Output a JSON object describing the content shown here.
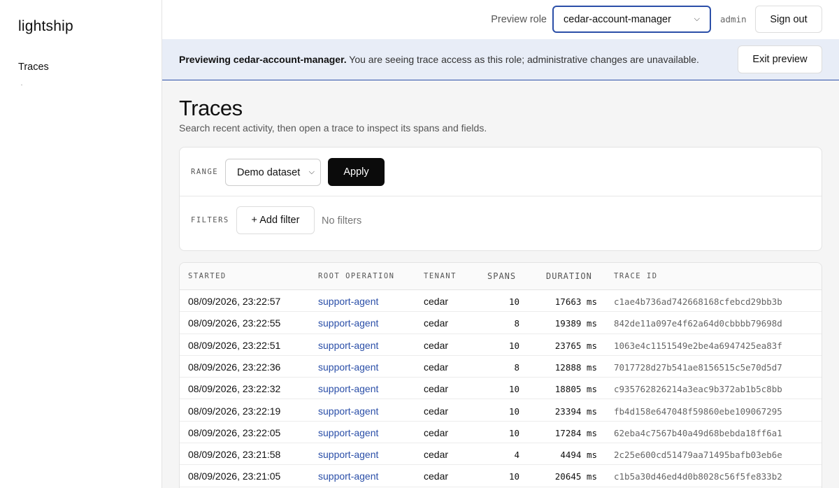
{
  "app": {
    "brand": "lightship"
  },
  "sidebar": {
    "items": [
      {
        "label": "Traces"
      }
    ]
  },
  "topbar": {
    "role_label": "Preview role",
    "role_value": "cedar-account-manager",
    "user": "admin",
    "signout_label": "Sign out"
  },
  "banner": {
    "bold": "Previewing cedar-account-manager.",
    "text": " You are seeing trace access as this role; administrative changes are unavailable.",
    "exit_label": "Exit preview"
  },
  "page": {
    "title": "Traces",
    "subtitle": "Search recent activity, then open a trace to inspect its spans and fields."
  },
  "filters": {
    "range_label": "RANGE",
    "range_value": "Demo dataset",
    "apply_label": "Apply",
    "filters_label": "FILTERS",
    "add_filter_label": "+ Add filter",
    "empty_label": "No filters"
  },
  "table": {
    "columns": [
      "STARTED",
      "ROOT OPERATION",
      "TENANT",
      "SPANS",
      "DURATION",
      "TRACE ID"
    ],
    "rows": [
      {
        "started": "08/09/2026, 23:22:57",
        "operation": "support-agent",
        "tenant": "cedar",
        "spans": "10",
        "duration": "17663 ms",
        "trace_id": "c1ae4b736ad742668168cfebcd29bb3b"
      },
      {
        "started": "08/09/2026, 23:22:55",
        "operation": "support-agent",
        "tenant": "cedar",
        "spans": "8",
        "duration": "19389 ms",
        "trace_id": "842de11a097e4f62a64d0cbbbb79698d"
      },
      {
        "started": "08/09/2026, 23:22:51",
        "operation": "support-agent",
        "tenant": "cedar",
        "spans": "10",
        "duration": "23765 ms",
        "trace_id": "1063e4c1151549e2be4a6947425ea83f"
      },
      {
        "started": "08/09/2026, 23:22:36",
        "operation": "support-agent",
        "tenant": "cedar",
        "spans": "8",
        "duration": "12888 ms",
        "trace_id": "7017728d27b541ae8156515c5e70d5d7"
      },
      {
        "started": "08/09/2026, 23:22:32",
        "operation": "support-agent",
        "tenant": "cedar",
        "spans": "10",
        "duration": "18805 ms",
        "trace_id": "c935762826214a3eac9b372ab1b5c8bb"
      },
      {
        "started": "08/09/2026, 23:22:19",
        "operation": "support-agent",
        "tenant": "cedar",
        "spans": "10",
        "duration": "23394 ms",
        "trace_id": "fb4d158e647048f59860ebe109067295"
      },
      {
        "started": "08/09/2026, 23:22:05",
        "operation": "support-agent",
        "tenant": "cedar",
        "spans": "10",
        "duration": "17284 ms",
        "trace_id": "62eba4c7567b40a49d68bebda18ff6a1"
      },
      {
        "started": "08/09/2026, 23:21:58",
        "operation": "support-agent",
        "tenant": "cedar",
        "spans": "4",
        "duration": "4494 ms",
        "trace_id": "2c25e600cd51479aa71495bafb03eb6e"
      },
      {
        "started": "08/09/2026, 23:21:05",
        "operation": "support-agent",
        "tenant": "cedar",
        "spans": "10",
        "duration": "20645 ms",
        "trace_id": "c1b5a30d46ed4d0b8028c56f5fe833b2"
      }
    ]
  }
}
